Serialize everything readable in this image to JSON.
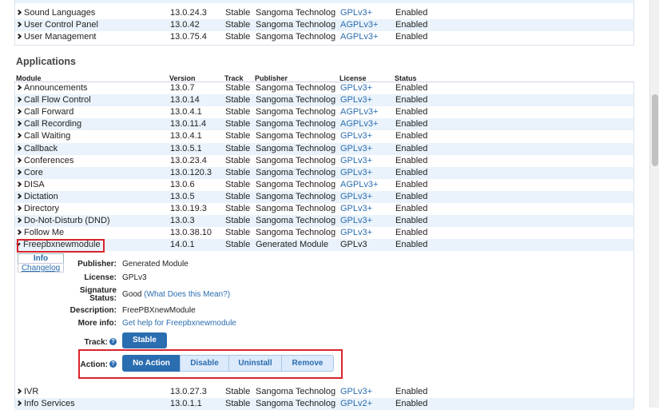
{
  "top_rows": [
    {
      "module": "Sound Languages",
      "version": "13.0.24.3",
      "track": "Stable",
      "publisher": "Sangoma Technologies",
      "license": "GPLv3+",
      "status": "Enabled"
    },
    {
      "module": "User Control Panel",
      "version": "13.0.42",
      "track": "Stable",
      "publisher": "Sangoma Technologies",
      "license": "AGPLv3+",
      "status": "Enabled"
    },
    {
      "module": "User Management",
      "version": "13.0.75.4",
      "track": "Stable",
      "publisher": "Sangoma Technologies",
      "license": "AGPLv3+",
      "status": "Enabled"
    }
  ],
  "section": {
    "title": "Applications"
  },
  "columns": {
    "module": "Module",
    "version": "Version",
    "track": "Track",
    "publisher": "Publisher",
    "license": "License",
    "status": "Status"
  },
  "app_rows": [
    {
      "module": "Announcements",
      "version": "13.0.7",
      "track": "Stable",
      "publisher": "Sangoma Technologies",
      "license": "GPLv3+",
      "status": "Enabled"
    },
    {
      "module": "Call Flow Control",
      "version": "13.0.14",
      "track": "Stable",
      "publisher": "Sangoma Technologies",
      "license": "GPLv3+",
      "status": "Enabled"
    },
    {
      "module": "Call Forward",
      "version": "13.0.4.1",
      "track": "Stable",
      "publisher": "Sangoma Technologies",
      "license": "AGPLv3+",
      "status": "Enabled"
    },
    {
      "module": "Call Recording",
      "version": "13.0.11.4",
      "track": "Stable",
      "publisher": "Sangoma Technologies",
      "license": "AGPLv3+",
      "status": "Enabled"
    },
    {
      "module": "Call Waiting",
      "version": "13.0.4.1",
      "track": "Stable",
      "publisher": "Sangoma Technologies",
      "license": "GPLv3+",
      "status": "Enabled"
    },
    {
      "module": "Callback",
      "version": "13.0.5.1",
      "track": "Stable",
      "publisher": "Sangoma Technologies",
      "license": "GPLv3+",
      "status": "Enabled"
    },
    {
      "module": "Conferences",
      "version": "13.0.23.4",
      "track": "Stable",
      "publisher": "Sangoma Technologies",
      "license": "GPLv3+",
      "status": "Enabled"
    },
    {
      "module": "Core",
      "version": "13.0.120.3",
      "track": "Stable",
      "publisher": "Sangoma Technologies",
      "license": "GPLv3+",
      "status": "Enabled"
    },
    {
      "module": "DISA",
      "version": "13.0.6",
      "track": "Stable",
      "publisher": "Sangoma Technologies",
      "license": "AGPLv3+",
      "status": "Enabled"
    },
    {
      "module": "Dictation",
      "version": "13.0.5",
      "track": "Stable",
      "publisher": "Sangoma Technologies",
      "license": "GPLv3+",
      "status": "Enabled"
    },
    {
      "module": "Directory",
      "version": "13.0.19.3",
      "track": "Stable",
      "publisher": "Sangoma Technologies",
      "license": "GPLv3+",
      "status": "Enabled"
    },
    {
      "module": "Do-Not-Disturb (DND)",
      "version": "13.0.3",
      "track": "Stable",
      "publisher": "Sangoma Technologies",
      "license": "GPLv3+",
      "status": "Enabled"
    },
    {
      "module": "Follow Me",
      "version": "13.0.38.10",
      "track": "Stable",
      "publisher": "Sangoma Technologies",
      "license": "GPLv3+",
      "status": "Enabled"
    }
  ],
  "selected_row": {
    "module": "Freepbxnewmodule",
    "version": "14.0.1",
    "track": "Stable",
    "publisher": "Generated Module",
    "license": "GPLv3",
    "status": "Enabled"
  },
  "subtabs": {
    "info": "Info",
    "changelog": "Changelog"
  },
  "details": {
    "publisher_label": "Publisher:",
    "publisher": "Generated Module",
    "license_label": "License:",
    "license": "GPLv3",
    "signature_label_1": "Signature",
    "signature_label_2": "Status:",
    "signature_value": "Good",
    "signature_link": "(What Does this Mean?)",
    "description_label": "Description:",
    "description": "FreePBXnewModule",
    "moreinfo_label": "More info:",
    "moreinfo_link": "Get help for Freepbxnewmodule",
    "track_label": "Track:",
    "track_button": "Stable",
    "action_label": "Action:",
    "help_glyph": "?"
  },
  "actions": [
    "No Action",
    "Disable",
    "Uninstall",
    "Remove"
  ],
  "bottom_rows": [
    {
      "module": "IVR",
      "version": "13.0.27.3",
      "track": "Stable",
      "publisher": "Sangoma Technologies",
      "license": "GPLv3+",
      "status": "Enabled"
    },
    {
      "module": "Info Services",
      "version": "13.0.1.1",
      "track": "Stable",
      "publisher": "Sangoma Technologies",
      "license": "GPLv2+",
      "status": "Enabled"
    }
  ],
  "colors": {
    "accent": "#2a6db0",
    "highlight_box": "#d9232d",
    "row_alt": "#eaf3fb"
  }
}
